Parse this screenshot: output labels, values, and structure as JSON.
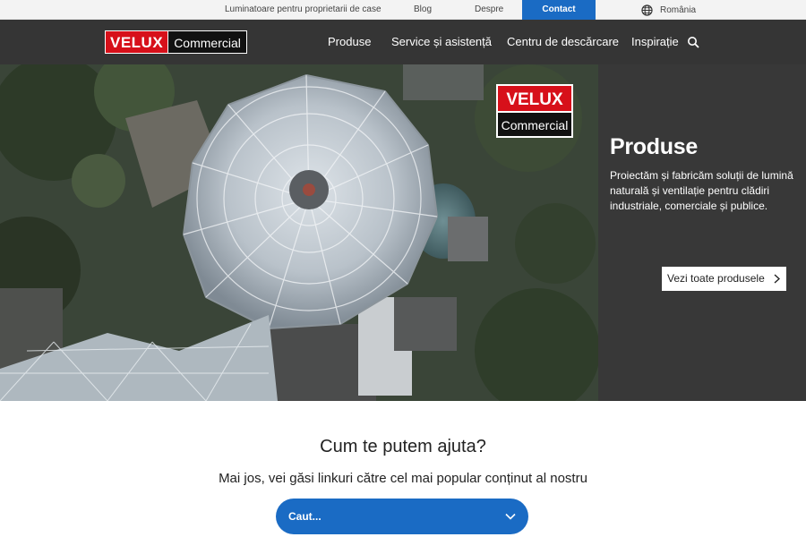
{
  "topbar": {
    "homeowners": "Luminatoare pentru proprietarii de case",
    "blog": "Blog",
    "about": "Despre",
    "contact": "Contact",
    "language": "România"
  },
  "nav": {
    "logo_brand": "VELUX",
    "logo_sub": "Commercial",
    "items": [
      "Produse",
      "Service și asistență",
      "Centru de descărcare",
      "Inspirație"
    ]
  },
  "hero": {
    "logo_brand": "VELUX",
    "logo_sub": "Commercial",
    "title": "Produse",
    "text": "Proiectăm și fabricăm soluții de lumină naturală și ventilație pentru clădiri industriale, comerciale și publice.",
    "cta": "Vezi toate produsele"
  },
  "help": {
    "title": "Cum te putem ajuta?",
    "subtitle": "Mai jos, vei găsi linkuri către cel mai popular conținut al nostru",
    "select_value": "Caut..."
  },
  "colors": {
    "brand_red": "#d7101a",
    "accent_blue": "#1a6bc4",
    "nav_bg": "#353535"
  }
}
